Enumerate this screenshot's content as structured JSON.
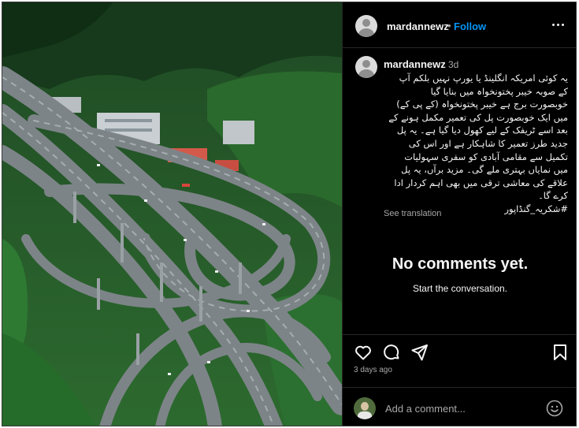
{
  "post": {
    "username": "mardannewz",
    "separator": "•",
    "follow_label": "Follow",
    "more_icon": "more-options-icon"
  },
  "caption": {
    "username": "mardannewz",
    "time": "3d",
    "text": "یہ کوئی امریکہ انگلینڈ یا یورپ نہیں بلکم آپ\nکے صوبہ خیبر پختونخواہ میں بنایا گیا\nخوبصورت برج ہے خیبر پختونخواہ (کے پی کے)\nمیں ایک خوبصورت پل کی تعمیر مکمل ہونے کے\nبعد اسے ٹریفک کے لیے کھول دیا گیا ہے۔ یہ پل\nجدید طرز تعمیر کا شاہکار ہے اور اس کی\nتکمیل سے مقامی آبادی کو سفری سہولیات\nمیں نمایاں بہتری ملے گی۔ مزید برآں، یہ پل\nعلاقے کی معاشی ترقی میں بھی اہم کردار ادا\nکرے گا۔\n#شکریہ_گنڈاپور",
    "see_translation": "See translation"
  },
  "comments": {
    "empty_title": "No comments yet.",
    "empty_subtitle": "Start the conversation."
  },
  "actions": {
    "like_icon": "heart-icon",
    "comment_icon": "comment-icon",
    "share_icon": "share-icon",
    "save_icon": "bookmark-icon",
    "posted_time": "3 days ago"
  },
  "comment_bar": {
    "placeholder": "Add a comment...",
    "emoji_icon": "emoji-icon"
  },
  "colors": {
    "background": "#000000",
    "text": "#f5f5f5",
    "muted": "#a8a8a8",
    "accent": "#0095f6",
    "divider": "#262626"
  }
}
